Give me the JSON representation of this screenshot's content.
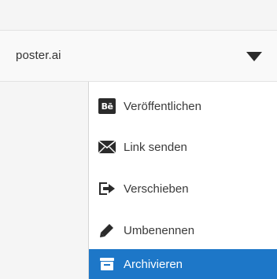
{
  "file": {
    "name": "poster.ai"
  },
  "menu": {
    "items": [
      {
        "label": "Veröffentlichen",
        "icon": "behance-icon",
        "behance_text": "Bē"
      },
      {
        "label": "Link senden",
        "icon": "envelope-icon"
      },
      {
        "label": "Verschieben",
        "icon": "move-arrow-icon"
      },
      {
        "label": "Umbenennen",
        "icon": "pencil-icon"
      },
      {
        "label": "Archivieren",
        "icon": "archive-icon",
        "active": true
      }
    ]
  },
  "colors": {
    "active_bg": "#1d77c8",
    "text": "#3a3a3a",
    "icon": "#2b2b2b"
  }
}
